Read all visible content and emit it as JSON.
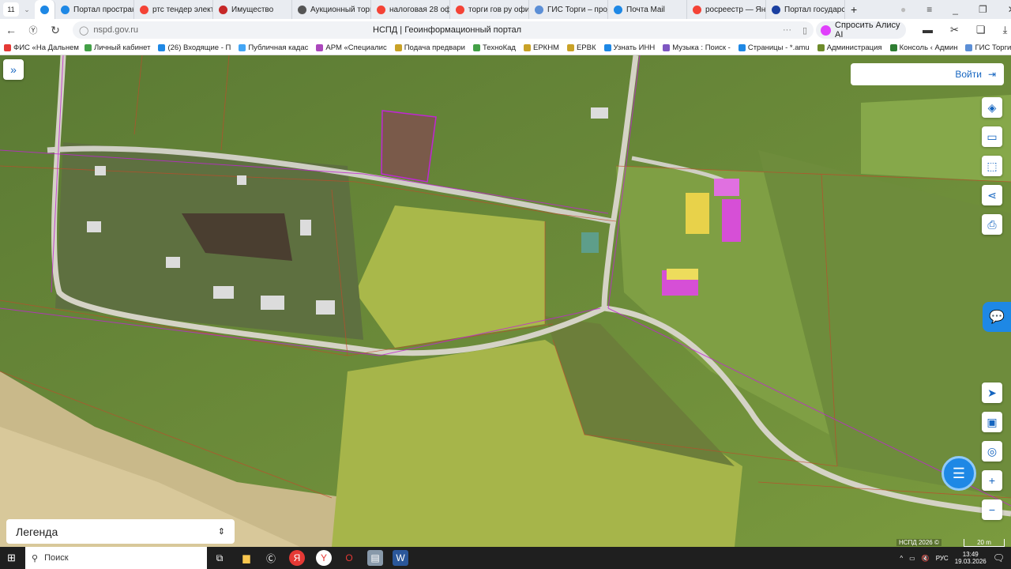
{
  "browser": {
    "tab_count": "11",
    "tabs": [
      {
        "label": "Портал простран",
        "icon": "portal-icon",
        "color": "#1e88e5"
      },
      {
        "label": "ртс тендер элект",
        "icon": "yandex-icon",
        "color": "#f44336"
      },
      {
        "label": "Имущество",
        "icon": "rts-icon",
        "color": "#c62828"
      },
      {
        "label": "Аукционный торг",
        "icon": "document-icon",
        "color": "#555555"
      },
      {
        "label": "налоговая 28 офи",
        "icon": "yandex-icon",
        "color": "#f44336"
      },
      {
        "label": "торги гов ру офи",
        "icon": "yandex-icon",
        "color": "#f44336"
      },
      {
        "label": "ГИС Торги – прод",
        "icon": "emblem-icon",
        "color": "#5c8fd6"
      },
      {
        "label": "Почта Mail",
        "icon": "mail-icon",
        "color": "#1e88e5"
      },
      {
        "label": "росреестр — Янд",
        "icon": "yandex-icon",
        "color": "#f44336"
      },
      {
        "label": "Портал государс",
        "icon": "flag-icon",
        "color": "#1a3fa0"
      }
    ],
    "url": "nspd.gov.ru",
    "page_title": "НСПД | Геоинформационный портал",
    "alice_label": "Спросить Алису AI",
    "bookmarks": [
      {
        "label": "ФИС «На Дальнем",
        "color": "#e53935"
      },
      {
        "label": "Личный кабинет",
        "color": "#43a047"
      },
      {
        "label": "(26) Входящие - П",
        "color": "#1e88e5"
      },
      {
        "label": "Публичная кадас",
        "color": "#42a5f5"
      },
      {
        "label": "АРМ «Специалис",
        "color": "#ab47bc"
      },
      {
        "label": "Подача предвари",
        "color": "#c9a227"
      },
      {
        "label": "ТехноКад",
        "color": "#43a047"
      },
      {
        "label": "ЕРКНМ",
        "color": "#c9a227"
      },
      {
        "label": "ЕРВК",
        "color": "#c9a227"
      },
      {
        "label": "Узнать ИНН",
        "color": "#1e88e5"
      },
      {
        "label": "Музыка : Поиск -",
        "color": "#7e57c2"
      },
      {
        "label": "Страницы - *.amu",
        "color": "#1e88e5"
      },
      {
        "label": "Администрация",
        "color": "#6d8b2a"
      },
      {
        "label": "Консоль ‹ Админ",
        "color": "#2e7d32"
      },
      {
        "label": "ГИС Торги -",
        "color": "#5c8fd6"
      }
    ]
  },
  "map": {
    "login_label": "Войти",
    "legend_label": "Легенда",
    "attribution": "НСПД 2026 ©",
    "scale_label": "20 m"
  },
  "taskbar": {
    "search_placeholder": "Поиск",
    "language": "РУС",
    "time": "13:49",
    "date": "19.03.2026"
  }
}
